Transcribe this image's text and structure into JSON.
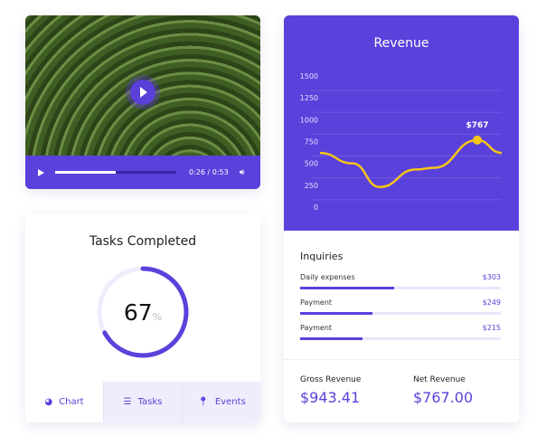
{
  "video": {
    "time": "0:26 / 0:53",
    "progress": 0.5
  },
  "tasks": {
    "title": "Tasks Completed",
    "value": "67",
    "unit": "%",
    "percent": 67,
    "tabs": [
      {
        "label": "Chart",
        "icon": "pie-chart-icon"
      },
      {
        "label": "Tasks",
        "icon": "list-icon"
      },
      {
        "label": "Events",
        "icon": "location-pin-icon"
      }
    ]
  },
  "revenue": {
    "title": "Revenue",
    "inquiries_title": "Inquiries",
    "inquiries": [
      {
        "label": "Daily expenses",
        "value": "$303",
        "fraction": 0.47
      },
      {
        "label": "Payment",
        "value": "$249",
        "fraction": 0.36
      },
      {
        "label": "Payment",
        "value": "$215",
        "fraction": 0.31
      }
    ],
    "gross_label": "Gross Revenue",
    "gross_value": "$943.41",
    "net_label": "Net Revenue",
    "net_value": "$767.00"
  },
  "chart_data": {
    "type": "line",
    "ylim": [
      0,
      1500
    ],
    "yticks": [
      "0",
      "250",
      "500",
      "750",
      "1000",
      "1250",
      "1500"
    ],
    "values": [
      620,
      500,
      230,
      430,
      450,
      767,
      620
    ],
    "highlight": {
      "index": 5,
      "label": "$767"
    },
    "color": "#f5c518",
    "grid": true
  }
}
